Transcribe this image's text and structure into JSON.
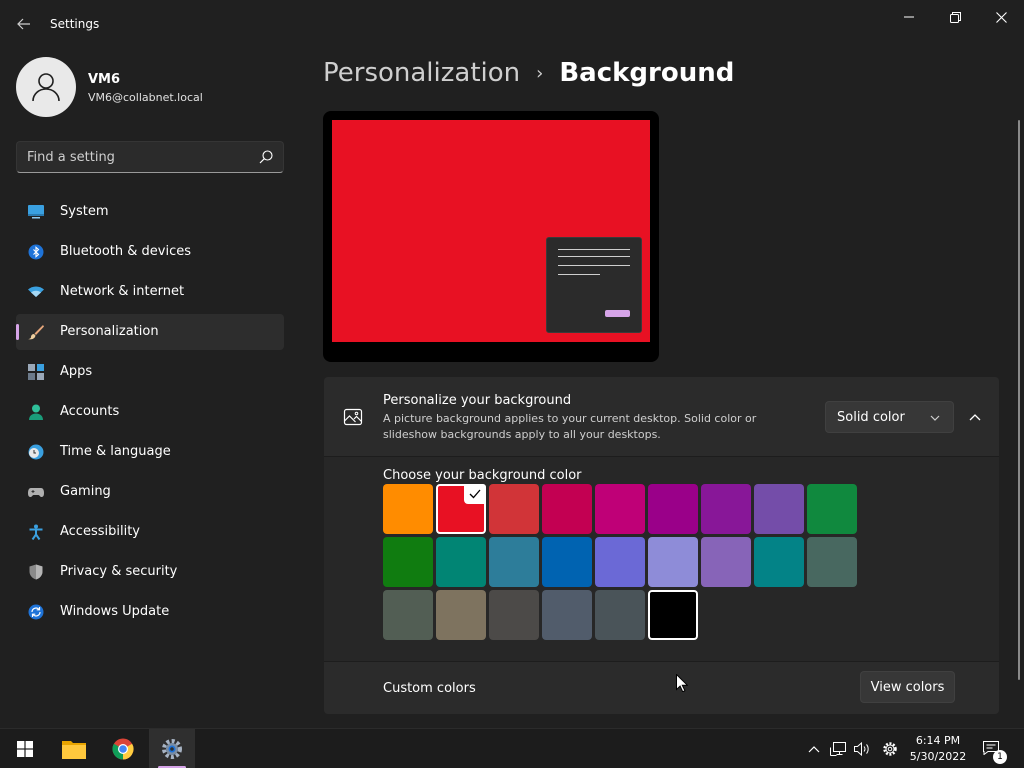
{
  "window": {
    "title": "Settings"
  },
  "profile": {
    "name": "VM6",
    "email": "VM6@collabnet.local"
  },
  "search": {
    "placeholder": "Find a setting"
  },
  "sidebar": {
    "items": [
      {
        "label": "System",
        "icon": "system-icon",
        "active": false
      },
      {
        "label": "Bluetooth & devices",
        "icon": "bluetooth-icon",
        "active": false
      },
      {
        "label": "Network & internet",
        "icon": "wifi-icon",
        "active": false
      },
      {
        "label": "Personalization",
        "icon": "brush-icon",
        "active": true
      },
      {
        "label": "Apps",
        "icon": "apps-icon",
        "active": false
      },
      {
        "label": "Accounts",
        "icon": "accounts-icon",
        "active": false
      },
      {
        "label": "Time & language",
        "icon": "clock-globe-icon",
        "active": false
      },
      {
        "label": "Gaming",
        "icon": "gamepad-icon",
        "active": false
      },
      {
        "label": "Accessibility",
        "icon": "accessibility-icon",
        "active": false
      },
      {
        "label": "Privacy & security",
        "icon": "shield-icon",
        "active": false
      },
      {
        "label": "Windows Update",
        "icon": "update-icon",
        "active": false
      }
    ]
  },
  "breadcrumb": {
    "parent": "Personalization",
    "separator": "›",
    "current": "Background"
  },
  "preview": {
    "background_color": "#e81123"
  },
  "personalize": {
    "title": "Personalize your background",
    "description": "A picture background applies to your current desktop. Solid color or slideshow backgrounds apply to all your desktops.",
    "selected_option": "Solid color"
  },
  "colors": {
    "label": "Choose your background color",
    "selected_index": 1,
    "swatches": [
      "#ff8c00",
      "#e81123",
      "#d13438",
      "#c30052",
      "#bf0077",
      "#9a0089",
      "#881798",
      "#744da9",
      "#10893e",
      "#107c10",
      "#018574",
      "#2d7d9a",
      "#0063b1",
      "#6b69d6",
      "#8e8cd8",
      "#8764b8",
      "#038387",
      "#486860",
      "#525e54",
      "#7e735f",
      "#4c4a48",
      "#515c6b",
      "#4a5459",
      "#000000"
    ]
  },
  "custom": {
    "label": "Custom colors",
    "button": "View colors"
  },
  "taskbar": {
    "apps": [
      "start-icon",
      "file-explorer-icon",
      "chrome-icon",
      "settings-icon"
    ],
    "time": "6:14 PM",
    "date": "5/30/2022",
    "notifications": "1"
  },
  "theme": {
    "accent": "#d6a4e8",
    "background": "#202020",
    "card": "#2b2b2b"
  }
}
